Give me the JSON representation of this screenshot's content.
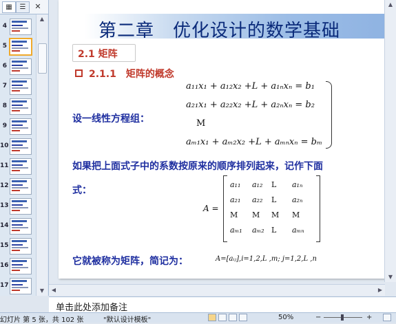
{
  "thumbnails": {
    "tab_icon_slides": "▦",
    "tab_icon_outline": "☰",
    "close_icon": "✕",
    "items": [
      {
        "num": "4"
      },
      {
        "num": "5"
      },
      {
        "num": "6"
      },
      {
        "num": "7"
      },
      {
        "num": "8"
      },
      {
        "num": "9"
      },
      {
        "num": "10"
      },
      {
        "num": "11"
      },
      {
        "num": "12"
      },
      {
        "num": "13"
      },
      {
        "num": "14"
      },
      {
        "num": "15"
      },
      {
        "num": "16"
      },
      {
        "num": "17"
      }
    ],
    "selected_num": "5"
  },
  "slide": {
    "title": "第二章　优化设计的数学基础",
    "section": "2.1  矩阵",
    "subsection": "2.1.1　矩阵的概念",
    "equations_label": "设一线性方程组：",
    "eq1": "a₁₁x₁ + a₁₂x₂ +L + a₁ₙxₙ = b₁",
    "eq2": "a₂₁x₁ + a₂₂x₂ +L + a₂ₙxₙ = b₂",
    "eq3": "M",
    "eq4": "aₘ₁x₁ + aₘ₂x₂ +L + aₘₙxₙ = bₘ",
    "sentence1": "如果把上面式子中的系数按原来的顺序排列起来，记作下面",
    "sentence2": "式：",
    "matrix_lhs": "A =",
    "matrix_rows": [
      [
        "a₁₁",
        "a₁₂",
        "L",
        "a₁ₙ"
      ],
      [
        "a₂₁",
        "a₂₂",
        "L",
        "a₂ₙ"
      ],
      [
        "M",
        "M",
        "M",
        "M"
      ],
      [
        "aₘ₁",
        "aₘ₂",
        "L",
        "aₘₙ"
      ]
    ],
    "conclusion": "它就被称为矩阵，简记为：",
    "notation": "A=[aᵢⱼ],i=1,2,L ,m; j=1,2,L ,n"
  },
  "notes": {
    "placeholder": "单击此处添加备注"
  },
  "status": {
    "slide_info": "幻灯片 第 5 张，共 102 张",
    "theme": "\"默认设计模板\"",
    "zoom": "50%",
    "zoom_minus": "−",
    "zoom_plus": "+"
  },
  "colors": {
    "title": "#0a2a7a",
    "accent": "#c0392b",
    "body": "#1f2fa0",
    "selection": "#f0a92b"
  }
}
